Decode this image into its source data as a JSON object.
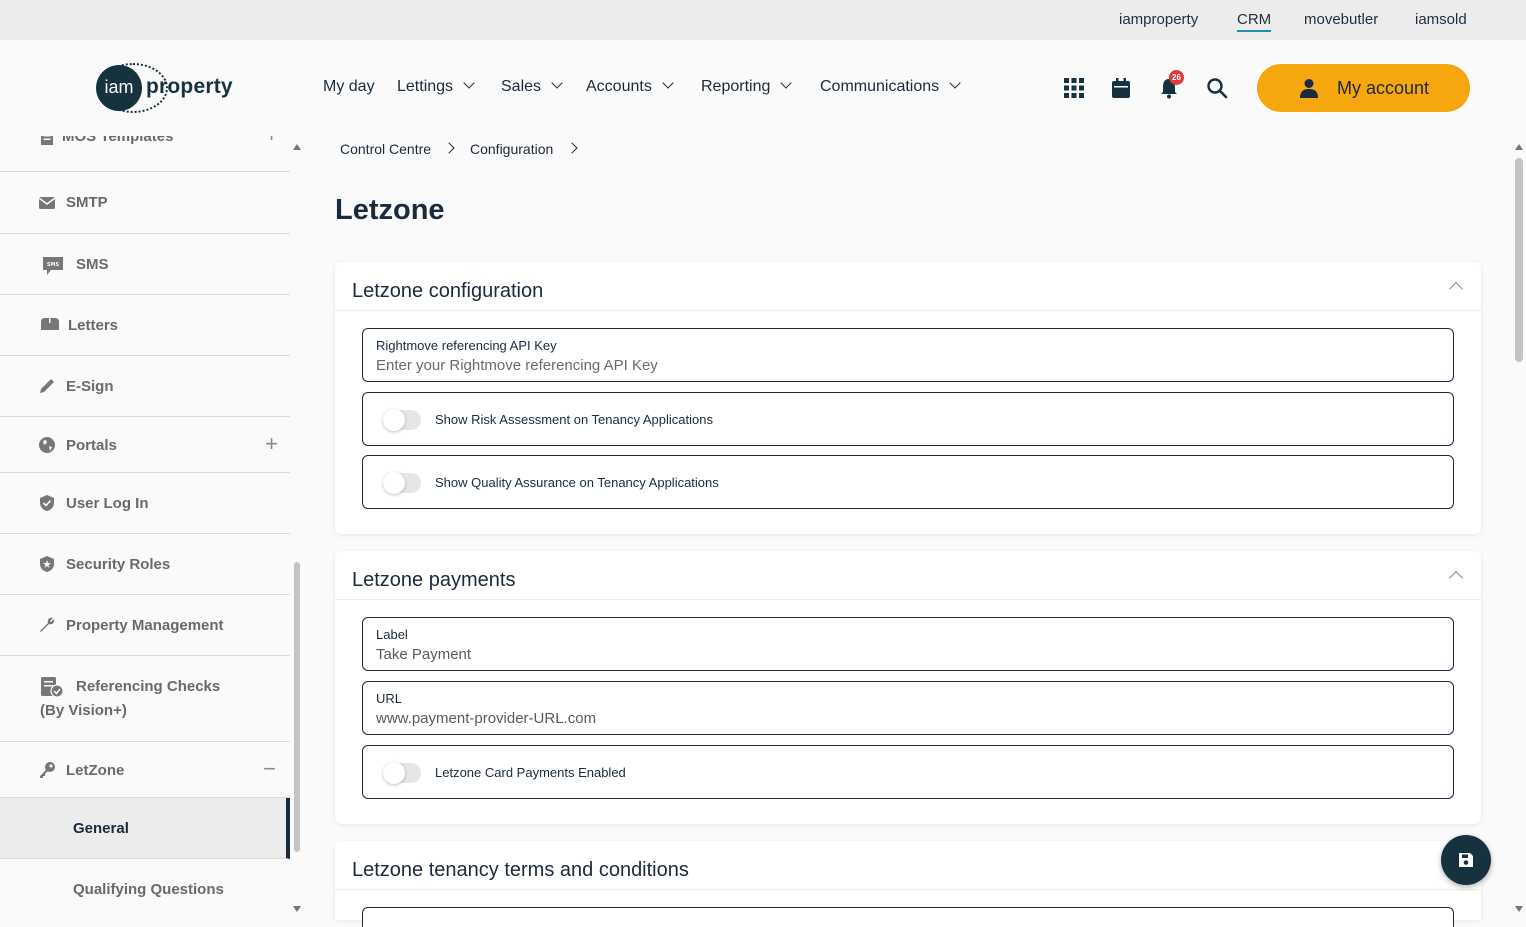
{
  "topbar": {
    "links": [
      "iamproperty",
      "CRM",
      "movebutler",
      "iamsold"
    ],
    "active": "CRM"
  },
  "logo": {
    "mark": "iam",
    "word": "property"
  },
  "nav": {
    "items": [
      "My day",
      "Lettings",
      "Sales",
      "Accounts",
      "Reporting",
      "Communications"
    ],
    "notification_count": "26",
    "my_account_label": "My account"
  },
  "sidebar": {
    "items": [
      {
        "label": "MOS Templates",
        "icon": "document-icon",
        "expand": "+"
      },
      {
        "label": "SMTP",
        "icon": "envelope-icon"
      },
      {
        "label": "SMS",
        "icon": "sms-icon"
      },
      {
        "label": "Letters",
        "icon": "mailbox-icon"
      },
      {
        "label": "E-Sign",
        "icon": "pencil-icon"
      },
      {
        "label": "Portals",
        "icon": "globe-icon",
        "expand": "+"
      },
      {
        "label": "User Log In",
        "icon": "shield-icon"
      },
      {
        "label": "Security Roles",
        "icon": "shield-star-icon"
      },
      {
        "label": "Property Management",
        "icon": "wrench-icon"
      },
      {
        "label": "Referencing Checks",
        "label2": "(By Vision+)",
        "icon": "check-document-icon"
      },
      {
        "label": "LetZone",
        "icon": "key-icon",
        "expand": "−"
      },
      {
        "label": "General"
      },
      {
        "label": "Qualifying Questions"
      }
    ]
  },
  "breadcrumb": [
    "Control Centre",
    "Configuration"
  ],
  "page_title": "Letzone",
  "sections": {
    "config": {
      "title": "Letzone configuration",
      "api_key_label": "Rightmove referencing API Key",
      "api_key_placeholder": "Enter your Rightmove referencing API Key",
      "toggle1_label": "Show Risk Assessment on Tenancy Applications",
      "toggle2_label": "Show Quality Assurance on Tenancy Applications"
    },
    "payments": {
      "title": "Letzone payments",
      "label_field_label": "Label",
      "label_field_value": "Take Payment",
      "url_field_label": "URL",
      "url_field_value": "www.payment-provider-URL.com",
      "toggle_label": "Letzone Card Payments Enabled"
    },
    "terms": {
      "title": "Letzone tenancy terms and conditions"
    }
  },
  "colors": {
    "accent": "#f6a60f",
    "navy": "#16323f",
    "badge": "#e23a3a",
    "link_underline": "#1a8fb0"
  }
}
